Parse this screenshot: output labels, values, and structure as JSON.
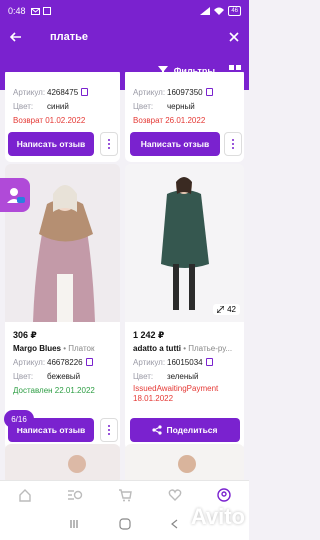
{
  "status": {
    "time": "0:48",
    "battery": "46"
  },
  "appbar": {
    "query": "платье"
  },
  "filters": {
    "label": "Фильтры"
  },
  "counter": "6/16",
  "top_cards": [
    {
      "article_label": "Артикул:",
      "article": "4268475",
      "color_label": "Цвет:",
      "color": "синий",
      "status": "Возврат 01.02.2022",
      "button": "Написать отзыв"
    },
    {
      "article_label": "Артикул:",
      "article": "16097350",
      "color_label": "Цвет:",
      "color": "черный",
      "status": "Возврат 26.01.2022",
      "button": "Написать отзыв"
    }
  ],
  "cards": [
    {
      "price": "306 ₽",
      "brand": "Margo Blues",
      "category": "Платок",
      "article_label": "Артикул:",
      "article": "46678226",
      "color_label": "Цвет:",
      "color": "бежевый",
      "status": "Доставлен 22.01.2022",
      "button": "Написать отзыв"
    },
    {
      "price": "1 242 ₽",
      "brand": "adatto a tutti",
      "category": "Платье-ру...",
      "article_label": "Артикул:",
      "article": "16015034",
      "color_label": "Цвет:",
      "color": "зеленый",
      "status_line1": "IssuedAwaitingPayment",
      "status_line2": "18.01.2022",
      "photo_count": "42",
      "button": "Поделиться"
    }
  ],
  "watermark": "Avito",
  "colors": {
    "accent": "#7a22cf",
    "return": "#e53935",
    "delivered": "#2e9e44"
  }
}
